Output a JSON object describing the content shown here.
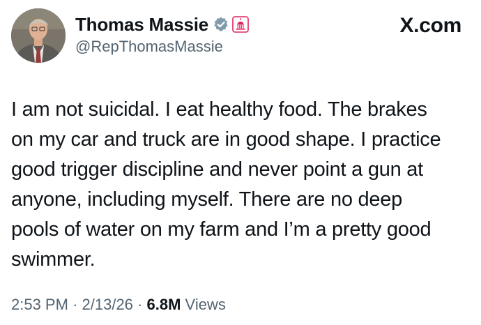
{
  "author": {
    "name": "Thomas Massie",
    "handle": "@RepThomasMassie",
    "verified_badge_color": "#829aab",
    "affiliation_badge_color": "#e0245e"
  },
  "brand": "X.com",
  "tweet": {
    "lines": [
      "I am not suicidal. I eat healthy food. The brakes",
      "on my car and truck are in good shape. I practice",
      "good trigger discipline and never point a gun at",
      "anyone,  including myself. There are no deep",
      "pools of water on my farm and I’m a pretty good",
      "swimmer."
    ]
  },
  "meta": {
    "time": "2:53 PM",
    "sep1": "·",
    "date": "2/13/26",
    "sep2": "·",
    "views_count": "6.8M",
    "views_label": "Views"
  }
}
